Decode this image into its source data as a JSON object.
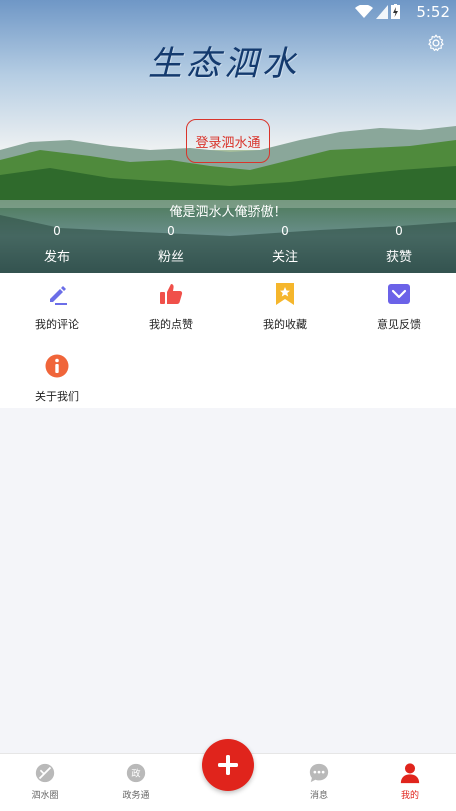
{
  "status_bar": {
    "time": "5:52"
  },
  "header": {
    "logo_text": "生态泗水",
    "login_label": "登录泗水通",
    "slogan": "俺是泗水人俺骄傲！",
    "stats": [
      {
        "value": "0",
        "label": "发布"
      },
      {
        "value": "0",
        "label": "粉丝"
      },
      {
        "value": "0",
        "label": "关注"
      },
      {
        "value": "0",
        "label": "获赞"
      }
    ]
  },
  "menu": {
    "items": [
      {
        "label": "我的评论",
        "icon": "edit-icon"
      },
      {
        "label": "我的点赞",
        "icon": "thumbs-up-icon"
      },
      {
        "label": "我的收藏",
        "icon": "bookmark-star-icon"
      },
      {
        "label": "意见反馈",
        "icon": "feedback-icon"
      },
      {
        "label": "关于我们",
        "icon": "info-icon"
      }
    ]
  },
  "bottom_nav": {
    "items": [
      {
        "label": "泗水圈",
        "icon": "circle-slash-icon"
      },
      {
        "label": "政务通",
        "icon": "gov-icon",
        "icon_text": "政"
      },
      {
        "label": "消息",
        "icon": "message-icon"
      },
      {
        "label": "我的",
        "icon": "user-icon",
        "active": true
      }
    ],
    "fab_icon": "plus-icon"
  },
  "colors": {
    "accent": "#e0241c",
    "edit": "#6b6ee8",
    "like": "#f0504a",
    "bookmark": "#f5b62c",
    "feedback": "#6b62e8",
    "info": "#f0653a"
  }
}
